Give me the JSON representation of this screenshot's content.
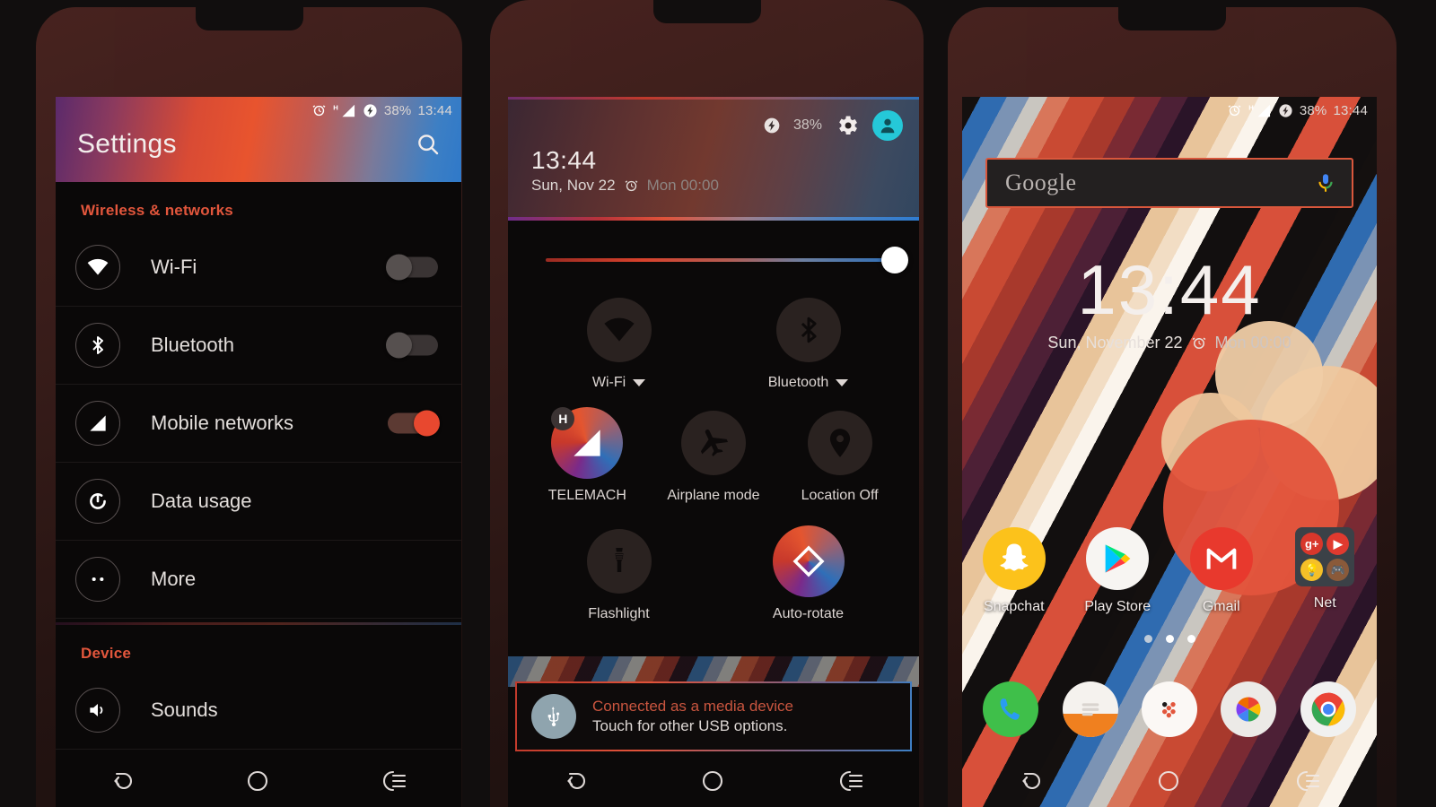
{
  "statusbar": {
    "battery": "38%",
    "time": "13:44",
    "network_letter": "H",
    "icons": [
      "alarm-icon",
      "signal-icon",
      "battery-charging-icon"
    ]
  },
  "phone1": {
    "title": "Settings",
    "search_icon": "search-icon",
    "sections": [
      {
        "heading": "Wireless & networks",
        "items": [
          {
            "label": "Wi-Fi",
            "icon": "wifi-icon",
            "toggle": "off"
          },
          {
            "label": "Bluetooth",
            "icon": "bluetooth-icon",
            "toggle": "off"
          },
          {
            "label": "Mobile networks",
            "icon": "signal-bars-icon",
            "toggle": "on"
          },
          {
            "label": "Data usage",
            "icon": "data-usage-icon",
            "toggle": "none"
          },
          {
            "label": "More",
            "icon": "more-dots-icon",
            "toggle": "none"
          }
        ]
      },
      {
        "heading": "Device",
        "items": [
          {
            "label": "Sounds",
            "icon": "volume-icon",
            "toggle": "none"
          }
        ]
      }
    ]
  },
  "phone2": {
    "battery": "38%",
    "settings_icon": "gear-icon",
    "avatar_icon": "user-avatar-icon",
    "clock": "13:44",
    "date": "Sun, Nov 22",
    "alarm_icon": "alarm-icon",
    "alarm_text": "Mon 00:00",
    "brightness_value": 96,
    "tiles_row1": [
      {
        "label": "Wi-Fi",
        "icon": "wifi-icon",
        "state": "off",
        "caret": true
      },
      {
        "label": "Bluetooth",
        "icon": "bluetooth-icon",
        "state": "off",
        "caret": true
      }
    ],
    "tiles_row2": [
      {
        "label": "TELEMACH",
        "icon": "signal-bars-icon",
        "state": "on",
        "badge": "H"
      },
      {
        "label": "Airplane mode",
        "icon": "airplane-icon",
        "state": "off"
      },
      {
        "label": "Location Off",
        "icon": "location-pin-icon",
        "state": "off"
      }
    ],
    "tiles_row3": [
      {
        "label": "Flashlight",
        "icon": "flashlight-icon",
        "state": "off"
      },
      {
        "label": "Auto-rotate",
        "icon": "auto-rotate-icon",
        "state": "on"
      }
    ],
    "notification": {
      "icon": "usb-icon",
      "title": "Connected as a media device",
      "subtitle": "Touch for other USB options."
    }
  },
  "phone3": {
    "search_placeholder": "Google",
    "mic_icon": "microphone-icon",
    "clock": "13:44",
    "date": "Sun, November 22",
    "alarm_icon": "alarm-icon",
    "alarm_text": "Mon 00:00",
    "apps": [
      {
        "label": "Snapchat",
        "icon": "snapchat-icon"
      },
      {
        "label": "Play Store",
        "icon": "play-store-icon"
      },
      {
        "label": "Gmail",
        "icon": "gmail-icon"
      },
      {
        "label": "Net",
        "icon": "folder-icon",
        "folder_items": [
          "google-plus-icon",
          "play-video-icon",
          "ideas-bulb-icon",
          "game-icon"
        ]
      }
    ],
    "page_dots": 3,
    "dock": [
      {
        "label": "Phone",
        "icon": "phone-icon"
      },
      {
        "label": "Messaging",
        "icon": "messaging-icon"
      },
      {
        "label": "App Drawer",
        "icon": "app-drawer-icon"
      },
      {
        "label": "Photos",
        "icon": "photos-icon"
      },
      {
        "label": "Chrome",
        "icon": "chrome-icon"
      }
    ]
  },
  "navbar": {
    "back": "back-icon",
    "home": "home-icon",
    "recents": "recents-icon"
  },
  "colors": {
    "accent_red": "#e2563c",
    "toggle_on": "#e8482f",
    "avatar_cyan": "#25c8d8",
    "search_border": "#d9573c"
  }
}
